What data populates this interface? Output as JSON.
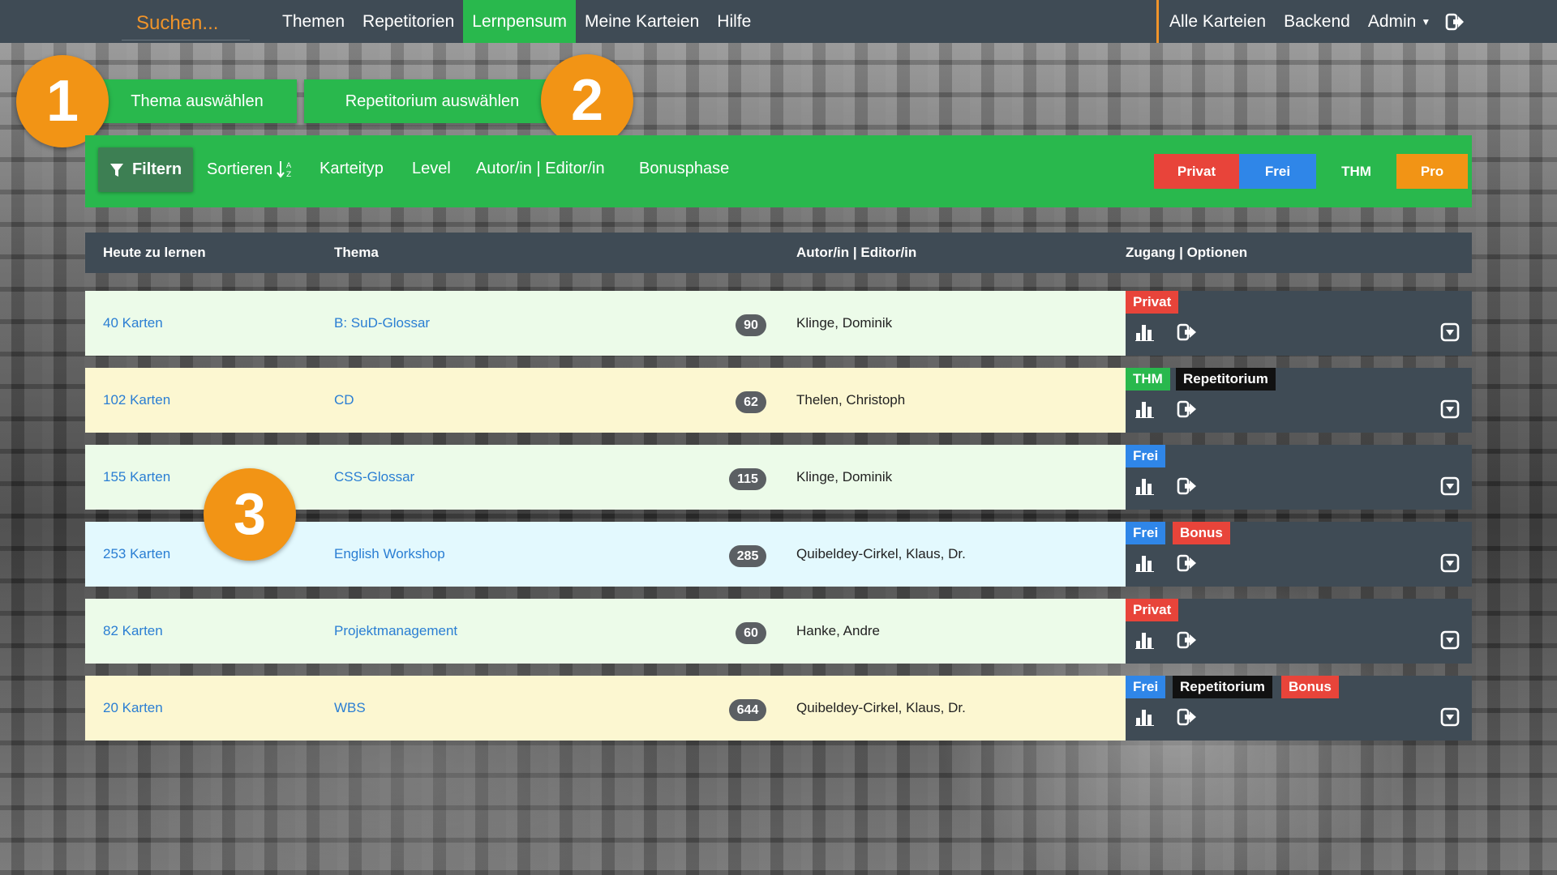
{
  "navbar": {
    "search_placeholder": "Suchen...",
    "items": [
      {
        "label": "Themen"
      },
      {
        "label": "Repetitorien"
      },
      {
        "label": "Lernpensum",
        "active": true
      },
      {
        "label": "Meine Karteien"
      },
      {
        "label": "Hilfe"
      }
    ],
    "right_items": [
      {
        "label": "Alle Karteien"
      },
      {
        "label": "Backend"
      },
      {
        "label": "Admin"
      }
    ],
    "logout_icon": "sign-out-icon"
  },
  "top_buttons": {
    "select_topic": "Thema auswählen",
    "select_repetitorium": "Repetitorium auswählen"
  },
  "callouts": [
    "1",
    "2",
    "3"
  ],
  "filterbar": {
    "filter": "Filtern",
    "sort": "Sortieren",
    "card_type": "Karteityp",
    "level": "Level",
    "author": "Autor/in | Editor/in",
    "bonus": "Bonusphase",
    "visibility": [
      {
        "label": "Privat",
        "color": "#e8443a"
      },
      {
        "label": "Frei",
        "color": "#2f86e8"
      },
      {
        "label": "THM",
        "color": "#29b84d"
      },
      {
        "label": "Pro",
        "color": "#f29415"
      }
    ]
  },
  "table": {
    "headers": {
      "today": "Heute zu lernen",
      "topic": "Thema",
      "author": "Autor/in | Editor/in",
      "access": "Zugang | Optionen"
    },
    "rows": [
      {
        "today": "40 Karten",
        "topic": "B: SuD-Glossar",
        "count": "90",
        "author": "Klinge, Dominik",
        "bg": "#ecfbe9",
        "tags": [
          {
            "label": "Privat",
            "color": "#e8443a"
          }
        ]
      },
      {
        "today": "102 Karten",
        "topic": "CD",
        "count": "62",
        "author": "Thelen, Christoph",
        "bg": "#fcf7d1",
        "tags": [
          {
            "label": "THM",
            "color": "#29b84d"
          },
          {
            "label": "Repetitorium",
            "color": "#111111"
          }
        ]
      },
      {
        "today": "155 Karten",
        "topic": "CSS-Glossar",
        "count": "115",
        "author": "Klinge, Dominik",
        "bg": "#ecfbe9",
        "tags": [
          {
            "label": "Frei",
            "color": "#2f86e8"
          }
        ]
      },
      {
        "today": "253 Karten",
        "topic": "English Workshop",
        "count": "285",
        "author": "Quibeldey-Cirkel, Klaus, Dr.",
        "bg": "#e3f9fe",
        "tags": [
          {
            "label": "Frei",
            "color": "#2f86e8"
          },
          {
            "label": "Bonus",
            "color": "#e8443a"
          }
        ]
      },
      {
        "today": "82 Karten",
        "topic": "Projektmanagement",
        "count": "60",
        "author": "Hanke, Andre",
        "bg": "#ecfbe9",
        "tags": [
          {
            "label": "Privat",
            "color": "#e8443a"
          }
        ]
      },
      {
        "today": "20 Karten",
        "topic": "WBS",
        "count": "644",
        "author": "Quibeldey-Cirkel, Klaus, Dr.",
        "bg": "#fcf7d1",
        "tags": [
          {
            "label": "Frei",
            "color": "#2f86e8"
          },
          {
            "label": "Repetitorium",
            "color": "#111111"
          },
          {
            "label": "Bonus",
            "color": "#e8443a"
          }
        ]
      }
    ]
  }
}
